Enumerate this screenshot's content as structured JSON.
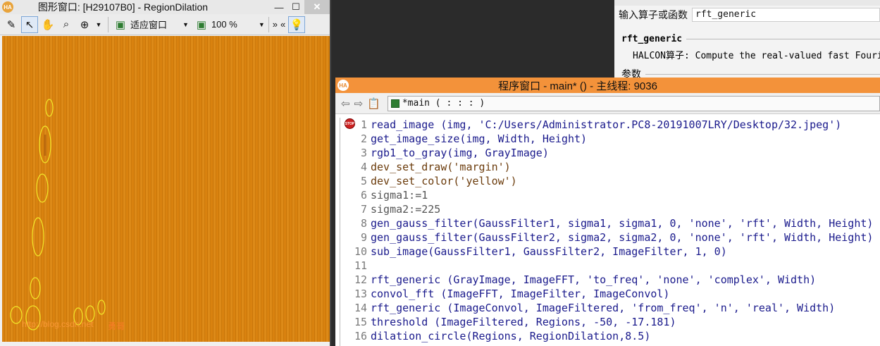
{
  "graphics_window": {
    "title": "图形窗口: [H29107B0] - RegionDilation",
    "logo": "HA",
    "min": "—",
    "max": "☐",
    "close": "✕",
    "toolbar": {
      "fit_label": "适应窗口",
      "zoom_label": "100 %",
      "more": "»",
      "less": "«"
    },
    "watermark_left": "http://blog.csdn.net",
    "watermark_right": "勇哥",
    "colors": {
      "image": "#d9820f",
      "regions": "#f2e92a"
    }
  },
  "operator_window": {
    "label": "输入算子或函数",
    "input_value": "rft_generic",
    "operator_name": "rft_generic",
    "description": "HALCON算子: Compute the real-valued fast Fourier transform of an image.",
    "params_label": "参数"
  },
  "program_window": {
    "title": "程序窗口 - main* () - 主线程: 9036",
    "logo": "HA",
    "tab_label": "*main ( : : : )",
    "breakpoint": "STOP",
    "lines": [
      {
        "n": "1",
        "text": "read_image (img, 'C:/Users/Administrator.PC8-20191007LRY/Desktop/32.jpeg')",
        "kind": "op"
      },
      {
        "n": "2",
        "text": "get_image_size(img, Width, Height)",
        "kind": "op"
      },
      {
        "n": "3",
        "text": "rgb1_to_gray(img, GrayImage)",
        "kind": "op"
      },
      {
        "n": "4",
        "text": "dev_set_draw('margin')",
        "kind": "ctl"
      },
      {
        "n": "5",
        "text": "dev_set_color('yellow')",
        "kind": "ctl"
      },
      {
        "n": "6",
        "text": "sigma1:=1",
        "kind": "var"
      },
      {
        "n": "7",
        "text": "sigma2:=225",
        "kind": "var"
      },
      {
        "n": "8",
        "text": "gen_gauss_filter(GaussFilter1, sigma1, sigma1, 0, 'none', 'rft', Width, Height)",
        "kind": "op"
      },
      {
        "n": "9",
        "text": "gen_gauss_filter(GaussFilter2, sigma2, sigma2, 0, 'none', 'rft', Width, Height)",
        "kind": "op"
      },
      {
        "n": "10",
        "text": "sub_image(GaussFilter1, GaussFilter2, ImageFilter, 1, 0)",
        "kind": "op"
      },
      {
        "n": "11",
        "text": "",
        "kind": "op"
      },
      {
        "n": "12",
        "text": "rft_generic (GrayImage, ImageFFT, 'to_freq', 'none', 'complex', Width)",
        "kind": "op"
      },
      {
        "n": "13",
        "text": "convol_fft (ImageFFT, ImageFilter, ImageConvol)",
        "kind": "op"
      },
      {
        "n": "14",
        "text": "rft_generic (ImageConvol, ImageFiltered, 'from_freq', 'n', 'real', Width)",
        "kind": "op"
      },
      {
        "n": "15",
        "text": "threshold (ImageFiltered, Regions, -50, -17.181)",
        "kind": "op"
      },
      {
        "n": "16",
        "text": "dilation_circle(Regions, RegionDilation,8.5)",
        "kind": "op"
      }
    ]
  }
}
